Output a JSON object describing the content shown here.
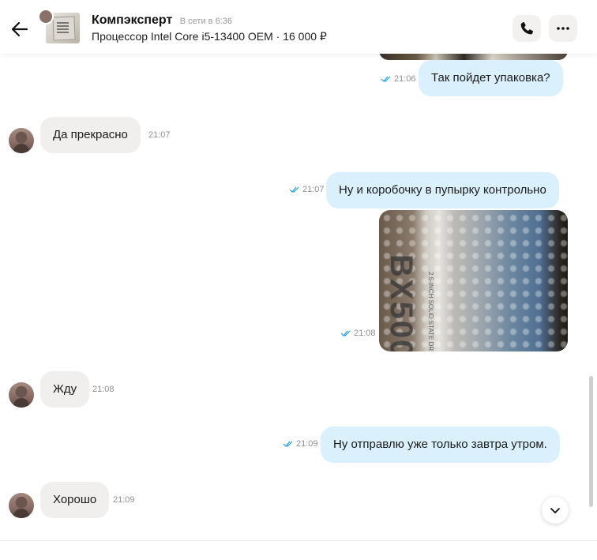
{
  "header": {
    "seller_name": "Компэксперт",
    "online_status": "В сети в 6:36",
    "listing": "Процессор Intel Core i5-13400 OEM · 16 000 ₽",
    "icons": {
      "back": "arrow-left-icon",
      "call": "phone-icon",
      "more": "more-dots-icon"
    }
  },
  "messages": [
    {
      "direction": "out",
      "type": "image",
      "time": ""
    },
    {
      "direction": "out",
      "text": "Так пойдет упаковка?",
      "time": "21:06",
      "read": true
    },
    {
      "direction": "in",
      "text": "Да прекрасно",
      "time": "21:07"
    },
    {
      "direction": "out",
      "text": "Ну и коробочку в пупырку контрольно",
      "time": "21:07",
      "read": true
    },
    {
      "direction": "out",
      "type": "image",
      "time": "21:08",
      "read": true,
      "image_text": "BX500",
      "image_subtext": "2.5-INCH SOLID STATE DRIVE"
    },
    {
      "direction": "in",
      "text": "Жду",
      "time": "21:08"
    },
    {
      "direction": "out",
      "text": "Ну отправлю уже только завтра утром.",
      "time": "21:09",
      "read": true
    },
    {
      "direction": "in",
      "text": "Хорошо",
      "time": "21:09"
    }
  ],
  "colors": {
    "outgoing_bubble": "#daf0fd",
    "incoming_bubble": "#f1efed",
    "read_ticks": "#1e9be6"
  }
}
